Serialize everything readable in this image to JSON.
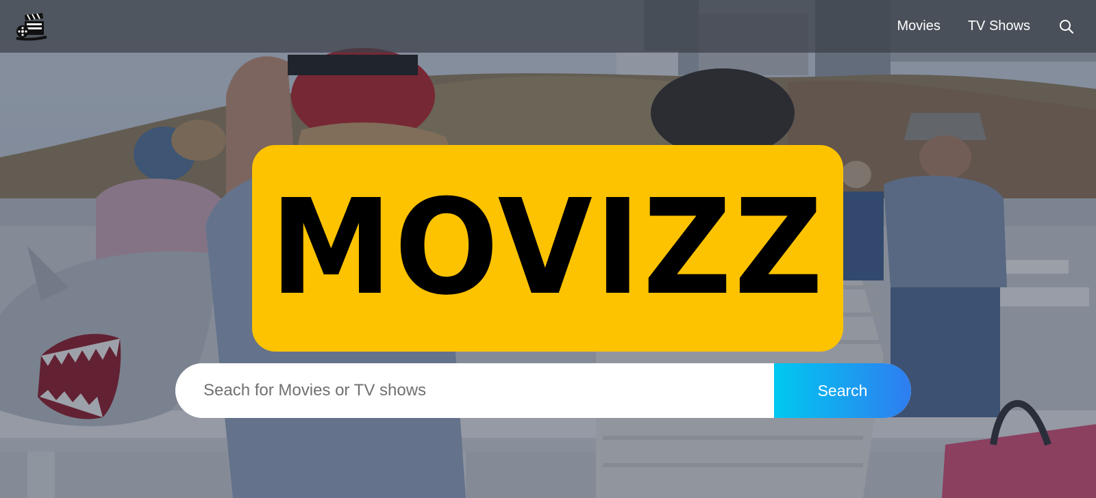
{
  "header": {
    "logo_icon": "clapperboard-film-icon",
    "nav": {
      "movies_label": "Movies",
      "tv_shows_label": "TV Shows"
    },
    "search_icon": "search-icon"
  },
  "hero": {
    "brand_title": "MOVIZZ",
    "search": {
      "placeholder": "Seach for Movies or TV shows",
      "value": "",
      "button_label": "Search"
    }
  },
  "colors": {
    "brand_yellow": "#fec300",
    "button_gradient_start": "#00c8f0",
    "button_gradient_end": "#2f7df0"
  }
}
